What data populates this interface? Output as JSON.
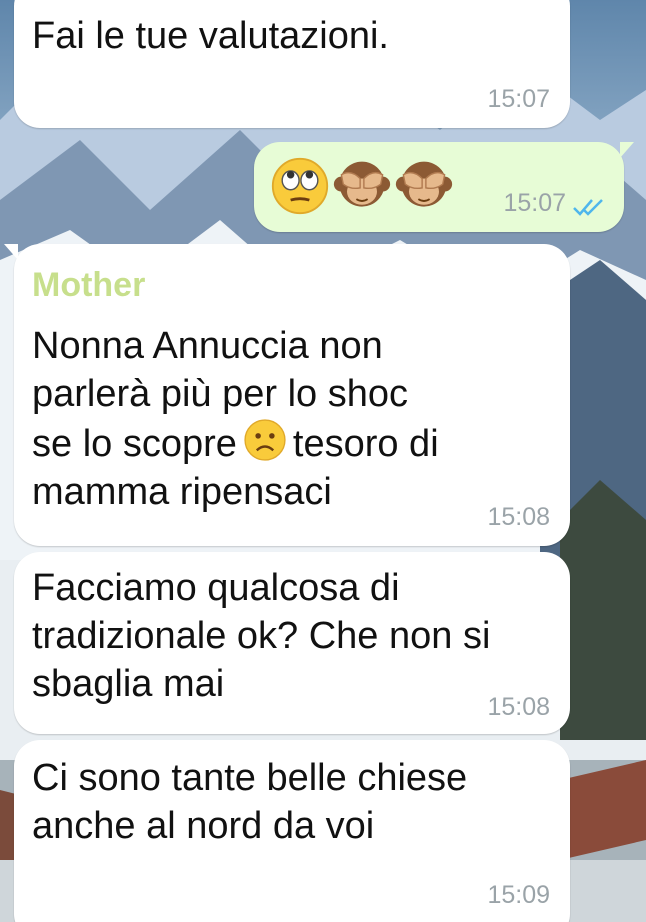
{
  "conversation": {
    "messages": [
      {
        "direction": "incoming",
        "text": "Fai le tue valutazioni.",
        "time": "15:07"
      },
      {
        "direction": "outgoing",
        "emojis": [
          "face-with-rolling-eyes",
          "see-no-evil-monkey",
          "see-no-evil-monkey"
        ],
        "time": "15:07",
        "status": "read"
      },
      {
        "direction": "incoming",
        "sender": "Mother",
        "text_before_emoji": "Nonna Annuccia non\nparlerà più per lo shoc\nse lo scopre",
        "inline_emoji": "frowning-face",
        "text_after_emoji": "tesoro di\nmamma ripensaci",
        "time": "15:08"
      },
      {
        "direction": "incoming",
        "text": "Facciamo qualcosa di\ntradizionale ok? Che non si\nsbaglia mai",
        "time": "15:08"
      },
      {
        "direction": "incoming",
        "text": "Ci sono tante belle chiese\nanche al nord da voi",
        "time": "15:09"
      }
    ]
  },
  "colors": {
    "incoming_bubble": "#ffffff",
    "outgoing_bubble": "#e7fcd6",
    "sender_name": "#c7df8c",
    "timestamp": "#9aa3a8",
    "read_ticks": "#4fb6ec"
  }
}
